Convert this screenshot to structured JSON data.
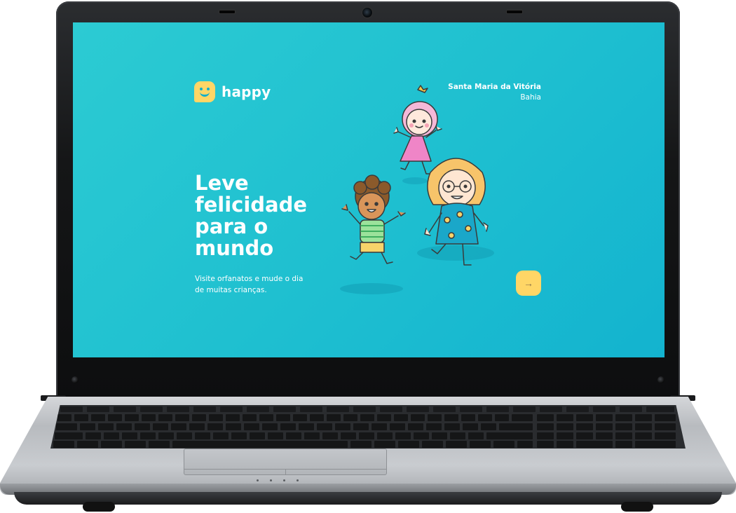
{
  "screen": {
    "logo": {
      "icon": "happy-face-logo-icon",
      "text": "happy"
    },
    "location": {
      "city": "Santa Maria da Vitória",
      "state": "Bahia"
    },
    "headline_lines": [
      "Leve",
      "felicidade",
      "para o",
      "mundo"
    ],
    "subtitle_lines": [
      "Visite orfanatos e mude o dia",
      "de muitas crianças."
    ],
    "cta": {
      "icon": "arrow-right-icon",
      "glyph": "→"
    },
    "colors": {
      "background": "#1ebfd0",
      "accent": "#ffd666",
      "text": "#ffffff"
    }
  },
  "device": {
    "type": "laptop",
    "illustration": "three-kids-illustration"
  }
}
